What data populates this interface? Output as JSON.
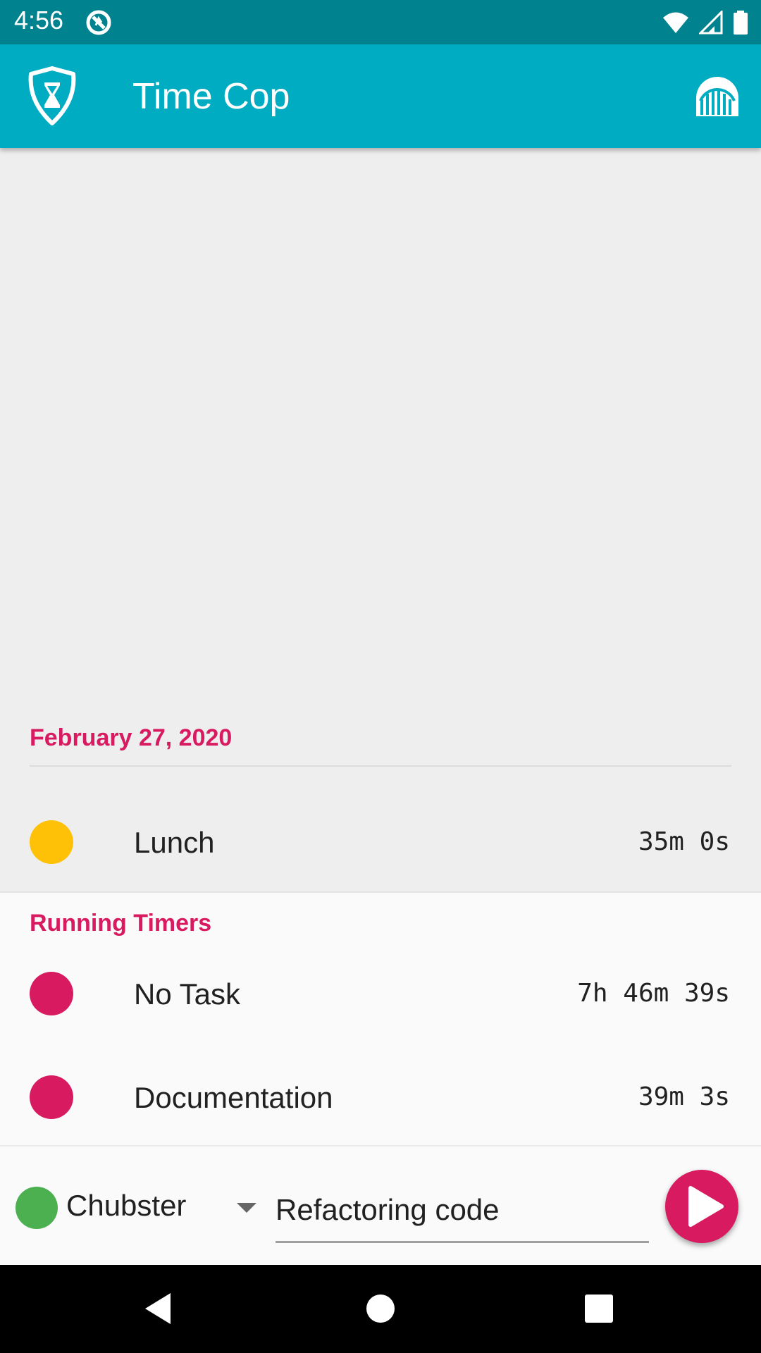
{
  "status_bar": {
    "time": "4:56",
    "icons": [
      "app-notification-icon",
      "wifi-icon",
      "signal-icon",
      "battery-icon"
    ]
  },
  "app_bar": {
    "title": "Time Cop",
    "logo_icon": "shield-hourglass-icon",
    "action_icon": "export-icon"
  },
  "history": {
    "date_header": "February 27, 2020",
    "entries": [
      {
        "label": "Lunch",
        "duration": "35m 0s",
        "color": "#ffc107"
      }
    ]
  },
  "running": {
    "title": "Running Timers",
    "timers": [
      {
        "label": "No Task",
        "duration": "7h 46m 39s",
        "color": "#d81b60"
      },
      {
        "label": "Documentation",
        "duration": "39m 3s",
        "color": "#d81b60"
      }
    ]
  },
  "new_timer": {
    "project": "Chubster",
    "project_color": "#4caf50",
    "description": "Refactoring code",
    "start_icon": "play-icon"
  },
  "nav": [
    "back-icon",
    "home-icon",
    "recents-icon"
  ],
  "colors": {
    "status_bar": "#00838f",
    "app_bar": "#00acc1",
    "accent": "#d81b60"
  }
}
